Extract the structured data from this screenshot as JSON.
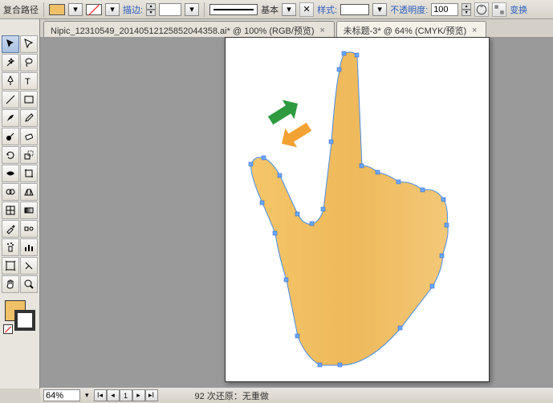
{
  "propbar": {
    "title_label": "复合路径",
    "stroke_label": "描边:",
    "stroke_pt": "",
    "basic_label": "基本",
    "style_label": "样式:",
    "opacity_label": "不透明度:",
    "opacity_value": "100",
    "transform_link": "变换"
  },
  "tabs": [
    {
      "label": "Nipic_12310549_20140512125852044358.ai* @ 100% (RGB/预览)"
    },
    {
      "label": "未标题-3* @ 64% (CMYK/预览)"
    }
  ],
  "tools": {
    "list": [
      "selection",
      "direct-selection",
      "magic-wand",
      "lasso",
      "pen",
      "type",
      "line",
      "rectangle",
      "paintbrush",
      "pencil",
      "blob-brush",
      "eraser",
      "rotate",
      "scale",
      "width",
      "free-transform",
      "shape-builder",
      "perspective",
      "mesh",
      "gradient",
      "eyedropper",
      "blend",
      "symbol-sprayer",
      "column-graph",
      "artboard",
      "slice",
      "hand",
      "zoom"
    ]
  },
  "status": {
    "zoom": "64%",
    "page": "1",
    "undo_text": "92 次还原：无重做"
  }
}
